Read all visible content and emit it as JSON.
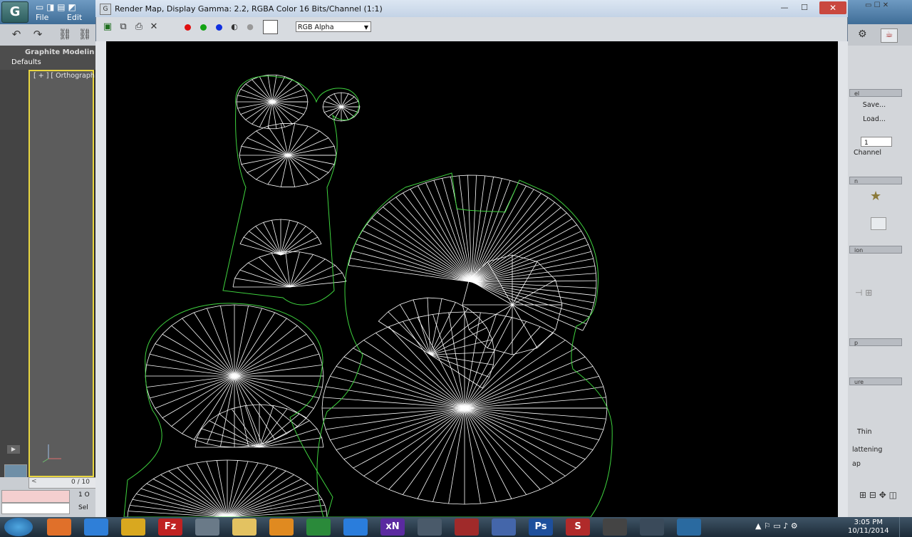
{
  "app": {
    "logo_label": "G",
    "menu": [
      "File",
      "Edit"
    ],
    "ribbon_title": "Graphite Modelin",
    "ribbon_tab": "Defaults",
    "viewport_label": "[ + ] [ Orthograph",
    "time_counter": "0 / 10",
    "status_field_1": "1 O",
    "status_field_2": "Sel"
  },
  "render_window": {
    "title": "Render Map, Display Gamma: 2.2, RGBA Color 16 Bits/Channel (1:1)",
    "title_icon": "G",
    "minimize": "—",
    "maximize": "☐",
    "close": "✕",
    "channel_select": "RGB Alpha",
    "channel_colors": {
      "red": "#e01010",
      "green": "#13a313",
      "blue": "#1030e0",
      "mono": "#555555"
    }
  },
  "command_panel": {
    "header_1": "el",
    "save_button": "Save...",
    "load_button": "Load...",
    "spinner_value": "1",
    "channel_label": "Channel",
    "header_2": "n",
    "header_3": "ion",
    "header_4": "p",
    "header_5": "ure",
    "thin_label": "Thin",
    "flattening_label": "lattening",
    "map_label": "ap"
  },
  "taskbar": {
    "time": "3:05 PM",
    "date": "10/11/2014",
    "apps": [
      "firefox",
      "internet-explorer",
      "chrome",
      "filezilla",
      "tool",
      "file-explorer",
      "media-player",
      "app",
      "dropbox",
      "xnormal",
      "app",
      "app",
      "app",
      "photoshop",
      "substance",
      "3ds-max",
      "app",
      "app"
    ],
    "app_labels": {
      "filezilla": "Fz",
      "xnormal": "xN",
      "photoshop": "Ps",
      "substance": "S"
    }
  }
}
